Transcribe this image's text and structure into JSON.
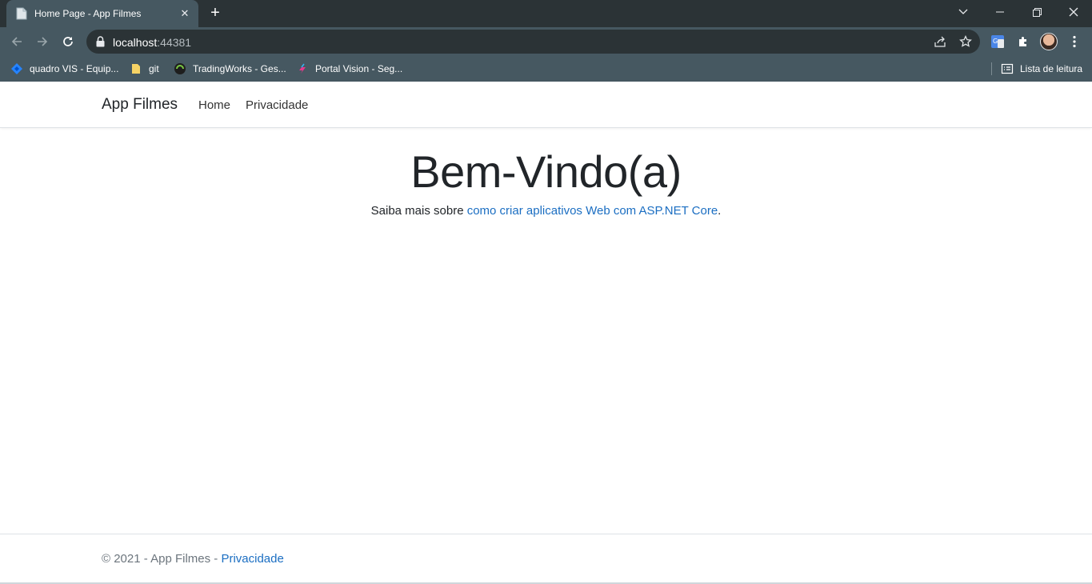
{
  "browser": {
    "tab_title": "Home Page - App Filmes",
    "url_host": "localhost",
    "url_port": ":44381",
    "bookmarks": [
      {
        "label": "quadro VIS - Equip...",
        "icon": "jira-icon"
      },
      {
        "label": "git",
        "icon": "folder-icon"
      },
      {
        "label": "TradingWorks - Ges...",
        "icon": "tradingworks-icon"
      },
      {
        "label": "Portal Vision - Seg...",
        "icon": "portal-vision-icon"
      }
    ],
    "reading_list_label": "Lista de leitura"
  },
  "site": {
    "brand": "App Filmes",
    "nav": [
      {
        "label": "Home"
      },
      {
        "label": "Privacidade"
      }
    ]
  },
  "main": {
    "title": "Bem-Vindo(a)",
    "text_prefix": "Saiba mais sobre ",
    "link_text": "como criar aplicativos Web com ASP.NET Core",
    "text_suffix": "."
  },
  "footer": {
    "text": "© 2021 - App Filmes - ",
    "link": "Privacidade"
  }
}
